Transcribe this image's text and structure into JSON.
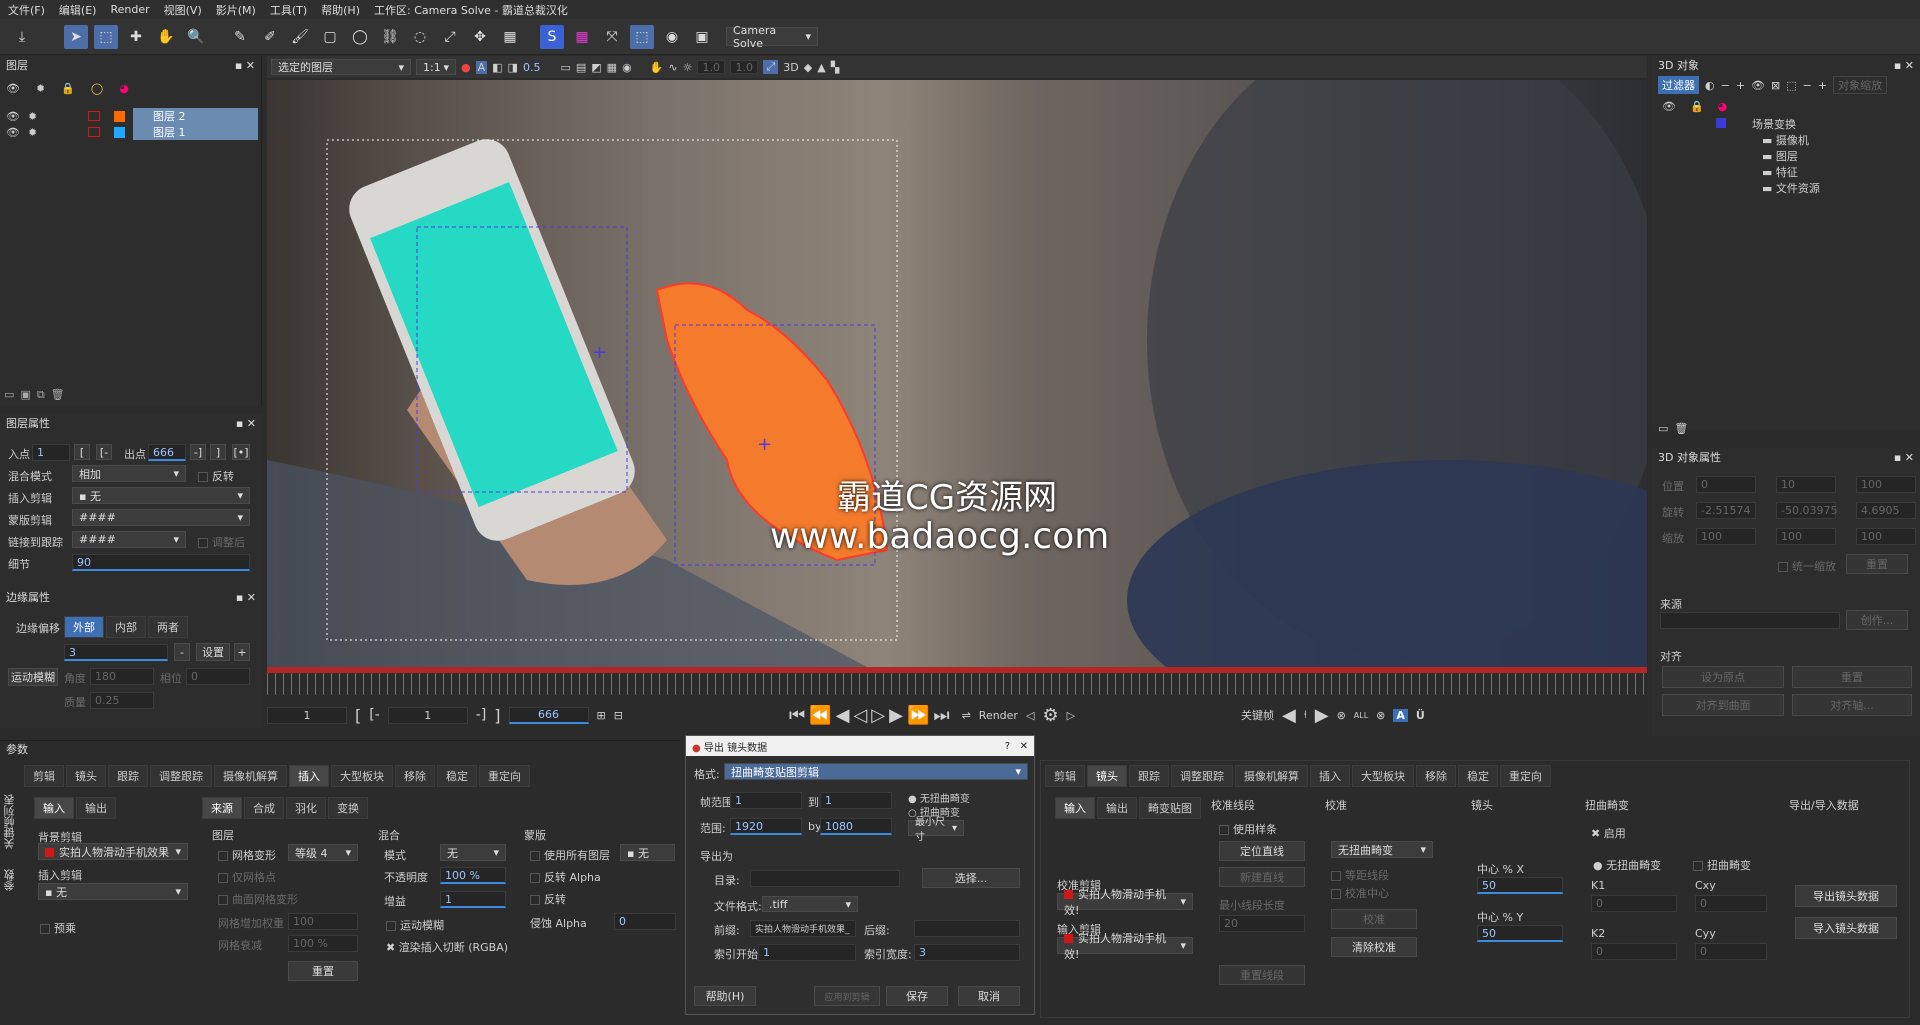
{
  "menu": [
    "文件(F)",
    "编辑(E)",
    "Render",
    "视图(V)",
    "影片(M)",
    "工具(T)",
    "帮助(H)",
    "工作区: Camera Solve - 霸道总裁汉化"
  ],
  "toolbar": {
    "workspace": "Camera Solve"
  },
  "layers": {
    "title": "图层",
    "items": [
      "图层 2",
      "图层 1"
    ],
    "colors": [
      "#ff6a00",
      "#1ea8ff"
    ]
  },
  "viewer_bar": {
    "layer_select": "选定的图层",
    "zoom": "1:1",
    "opacity": "0.5",
    "v1": "1.0",
    "v2": "1.0",
    "mode3d": "3D"
  },
  "watermark": {
    "line1": "霸道CG资源网",
    "line2": "www.badaocg.com"
  },
  "layer_props": {
    "title": "图层属性",
    "in_label": "入点",
    "in": "1",
    "out_label": "出点",
    "out": "666",
    "blend_label": "混合模式",
    "blend": "相加",
    "invert": "反转",
    "insert_label": "插入剪辑",
    "insert": "无",
    "matte_label": "蒙版剪辑",
    "matte": "####",
    "link_label": "链接到跟踪",
    "link": "####",
    "adjust": "调整后",
    "detail_label": "细节",
    "detail": "90"
  },
  "edge_props": {
    "title": "边缘属性",
    "offset_label": "边缘偏移",
    "tabs": [
      "外部",
      "内部",
      "两者"
    ],
    "value": "3",
    "set": "设置",
    "motion_blur": "运动模糊",
    "angle_label": "角度",
    "angle": "180",
    "phase_label": "相位",
    "phase": "0",
    "quality_label": "质量",
    "quality": "0.25"
  },
  "timeline": {
    "start": "1",
    "in": "1",
    "end": "666",
    "render": "Render",
    "keyframe": "关键帧",
    "all": "ALL"
  },
  "obj3d": {
    "title": "3D 对象",
    "filter": "过滤器",
    "zoom_btn": "对象缩放",
    "tree": [
      "场景变换",
      "摄像机",
      "图层",
      "特征",
      "文件资源"
    ]
  },
  "obj3d_props": {
    "title": "3D 对象属性",
    "pos_label": "位置",
    "rot_label": "旋转",
    "scale_label": "缩放",
    "px": "0",
    "py": "10",
    "pz": "100",
    "rx": "-2.51574",
    "ry": "-50.03975",
    "rz": "4.6905",
    "sx": "100",
    "sy": "100",
    "sz": "100",
    "uniform": "统一缩放",
    "reset": "重置",
    "source_label": "来源",
    "create": "创作...",
    "align_label": "对齐",
    "b1": "设为原点",
    "b2": "重置",
    "b3": "对齐到曲面",
    "b4": "对齐轴..."
  },
  "params": {
    "title": "参数",
    "side": [
      "参数",
      "关键帧列表"
    ],
    "tabs": [
      "剪辑",
      "镜头",
      "跟踪",
      "调整跟踪",
      "摄像机解算",
      "插入",
      "大型板块",
      "移除",
      "稳定",
      "重定向"
    ],
    "io_tabs": [
      "输入",
      "输出"
    ],
    "sub_tabs": [
      "来源",
      "合成",
      "羽化",
      "变换"
    ],
    "bg_label": "背景剪辑",
    "bg": "实拍人物滑动手机效果",
    "ins_label": "插入剪辑",
    "ins": "无",
    "preview": "预乘",
    "layer_label": "图层",
    "mesh_warp": "网格变形",
    "level": "等级 4",
    "mesh_pts": "仅网格点",
    "curve_mesh": "曲面网格变形",
    "mesh_add": "网格增加权重",
    "mesh_add_v": "100",
    "mesh_reduce": "网格衰减",
    "mesh_reduce_v": "100 %",
    "reset": "重置",
    "mix_label": "混合",
    "mode_label": "模式",
    "mode": "无",
    "opacity_label": "不透明度",
    "opacity": "100 %",
    "gain_label": "增益",
    "gain": "1",
    "motion_blur": "运动模糊",
    "render_cut": "渲染插入切断 (RGBA)",
    "matte_label": "蒙版",
    "all_layers": "使用所有图层",
    "none": "无",
    "inv_alpha": "反转 Alpha",
    "invert": "反转",
    "erode_label": "侵蚀 Alpha",
    "erode": "0"
  },
  "dialog": {
    "title": "导出 镜头数据",
    "format_label": "格式:",
    "format": "扭曲畸变贴图剪辑",
    "frames_label": "帧范围:",
    "f_from": "1",
    "to_label": "到",
    "f_to": "1",
    "r1": "无扭曲畸变",
    "r2": "扭曲畸变",
    "range_label": "范围:",
    "w": "1920",
    "by_label": "by",
    "h": "1080",
    "minsize": "最小尺寸",
    "export_as": "导出为",
    "dir_label": "目录:",
    "browse": "选择...",
    "ftype_label": "文件格式:",
    "ftype": ".tiff",
    "prefix_label": "前缀:",
    "prefix": "实拍人物滑动手机效果_",
    "suffix_label": "后缀:",
    "idx_label": "索引开始:",
    "idx": "1",
    "width_label": "索引宽度:",
    "width": "3",
    "help": "帮助(H)",
    "save_btn": "保存",
    "cancel": "取消",
    "apply": "应用到剪辑"
  },
  "lens": {
    "tabs": [
      "剪辑",
      "镜头",
      "跟踪",
      "调整跟踪",
      "摄像机解算",
      "插入",
      "大型板块",
      "移除",
      "稳定",
      "重定向"
    ],
    "sub_tabs": [
      "输入",
      "输出",
      "畸变贴图"
    ],
    "calib_lines": "校准线段",
    "use_spline": "使用样条",
    "locate": "定位直线",
    "new_line": "新建直线",
    "calib_clip_label": "校准剪辑",
    "calib_clip": "实拍人物滑动手机效!",
    "in_clip_label": "输入剪辑",
    "in_clip": "实拍人物滑动手机效!",
    "min_len": "最小线段长度",
    "min_len_v": "20",
    "reset_lines": "重置线段",
    "calib_label": "校准",
    "calib_mode": "无扭曲畸变",
    "eq_lines": "等距线段",
    "calib_center": "校准中心",
    "calibrate": "校准",
    "clear": "清除校准",
    "lens_label": "镜头",
    "cx_label": "中心 % X",
    "cx": "50",
    "cy_label": "中心 % Y",
    "cy": "50",
    "dist_label": "扭曲畸变",
    "enable": "启用",
    "nodist": "无扭曲畸变",
    "dist": "扭曲畸变",
    "k1": "K1",
    "k1v": "0",
    "cxy": "Cxy",
    "cxyv": "0",
    "k2": "K2",
    "k2v": "0",
    "cyy": "Cyy",
    "cyyv": "0",
    "io_label": "导出/导入数据",
    "export": "导出镜头数据",
    "import": "导入镜头数据"
  }
}
